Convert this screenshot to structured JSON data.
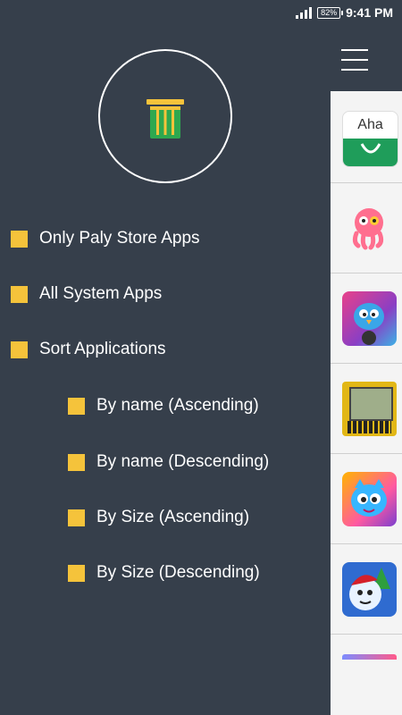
{
  "status_bar": {
    "battery": "82%",
    "time": "9:41 PM"
  },
  "header": {
    "menu_icon": "hamburger-icon",
    "clean_icon": "trash-can-icon"
  },
  "options": [
    {
      "label": "Only Paly Store Apps",
      "checked": true
    },
    {
      "label": "All System Apps",
      "checked": true
    },
    {
      "label": "Sort Applications",
      "checked": true
    }
  ],
  "sort_options": [
    {
      "label": "By name (Ascending)",
      "checked": true
    },
    {
      "label": "By name (Descending)",
      "checked": true
    },
    {
      "label": "By Size (Ascending)",
      "checked": true
    },
    {
      "label": "By Size (Descending)",
      "checked": true
    }
  ],
  "apps": [
    {
      "icon": "aha-shopping-bag-icon",
      "label": "Aha"
    },
    {
      "icon": "octopus-icon"
    },
    {
      "icon": "blue-bird-game-icon"
    },
    {
      "icon": "brick-game-icon"
    },
    {
      "icon": "cat-game-icon"
    },
    {
      "icon": "snowman-game-icon"
    },
    {
      "icon": "partial-app-icon"
    }
  ],
  "colors": {
    "drawer_bg": "#363f4b",
    "checkbox": "#f5c33b",
    "text": "#ffffff"
  }
}
